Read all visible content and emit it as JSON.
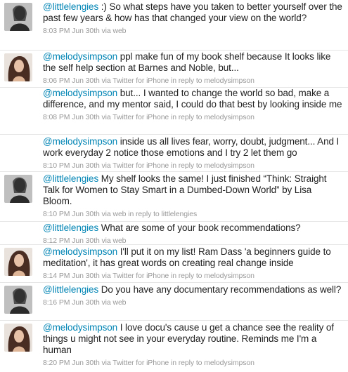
{
  "colors": {
    "mention_blue": "#0084b4",
    "meta_gray": "#999999",
    "text": "#222222"
  },
  "tweets": [
    {
      "avatar": "avatar-littlelengies",
      "handle": "@littlelengies",
      "text": " :) So what steps have you taken to better yourself over the past few years & how has that changed your view on the world?",
      "meta": "8:03 PM Jun 30th via web"
    },
    {
      "avatar": "avatar-melodysimpson",
      "handle": "@melodysimpson",
      "text": " ppl make fun of my book shelf because It looks like the self help section at Barnes and Noble, but...",
      "meta": "8:06 PM Jun 30th via Twitter for iPhone in reply to melodysimpson"
    },
    {
      "avatar": "",
      "handle": "@melodysimpson",
      "text": " but... I wanted to change the world so bad, make a difference, and my mentor said, I could do that best by looking inside me",
      "meta": "8:08 PM Jun 30th via Twitter for iPhone in reply to melodysimpson"
    },
    {
      "avatar": "",
      "handle": "@melodysimpson",
      "text": " inside us all lives fear, worry, doubt, judgment... And I work everyday 2 notice those emotions and I try 2 let them go",
      "meta": "8:10 PM Jun 30th via Twitter for iPhone in reply to melodysimpson"
    },
    {
      "avatar": "avatar-littlelengies",
      "handle": "@littlelengies",
      "text": " My shelf looks the same! I just finished “Think: Straight Talk for Women to Stay Smart in a Dumbed-Down World” by Lisa Bloom.",
      "meta": "8:10 PM Jun 30th via web in reply to littlelengies"
    },
    {
      "avatar": "",
      "handle": "@littlelengies",
      "text": " What are some of your book recommendations?",
      "meta": "8:12 PM Jun 30th via web"
    },
    {
      "avatar": "avatar-melodysimpson",
      "handle": "@melodysimpson",
      "text": " I'll put it on my list! Ram Dass 'a beginners guide to meditation', it has great words on creating real change inside",
      "meta": "8:14 PM Jun 30th via Twitter for iPhone in reply to melodysimpson"
    },
    {
      "avatar": "avatar-littlelengies",
      "handle": "@littlelengies",
      "text": " Do you have any documentary recommendations as well?",
      "meta": "8:16 PM Jun 30th via web"
    },
    {
      "avatar": "avatar-melodysimpson",
      "handle": "@melodysimpson",
      "text": " I love docu's cause u get a chance see the reality of things u might not see in your everyday routine. Reminds me I'm a human",
      "meta": "8:20 PM Jun 30th via Twitter for iPhone in reply to melodysimpson"
    }
  ]
}
